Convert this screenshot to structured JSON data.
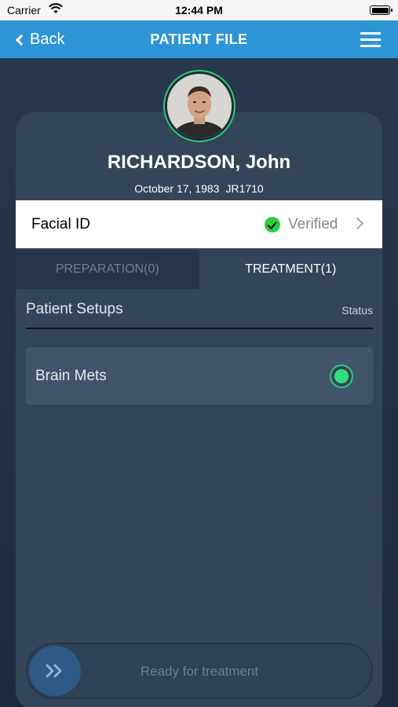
{
  "status_bar": {
    "carrier": "Carrier",
    "time": "12:44 PM"
  },
  "nav": {
    "back_label": "Back",
    "title": "PATIENT FILE"
  },
  "patient": {
    "name": "RICHARDSON, John",
    "dob": "October 17, 1983",
    "id": "JR1710"
  },
  "facial_id": {
    "label": "Facial ID",
    "status": "Verified"
  },
  "tabs": [
    {
      "label": "PREPARATION(0)",
      "active": false
    },
    {
      "label": "TREATMENT(1)",
      "active": true
    }
  ],
  "setups": {
    "title": "Patient Setups",
    "status_header": "Status",
    "items": [
      {
        "name": "Brain Mets",
        "status": "active"
      }
    ]
  },
  "action": {
    "label": "Ready for treatment"
  },
  "colors": {
    "accent": "#2d95d6",
    "success": "#2ecc71",
    "card": "#334559"
  }
}
